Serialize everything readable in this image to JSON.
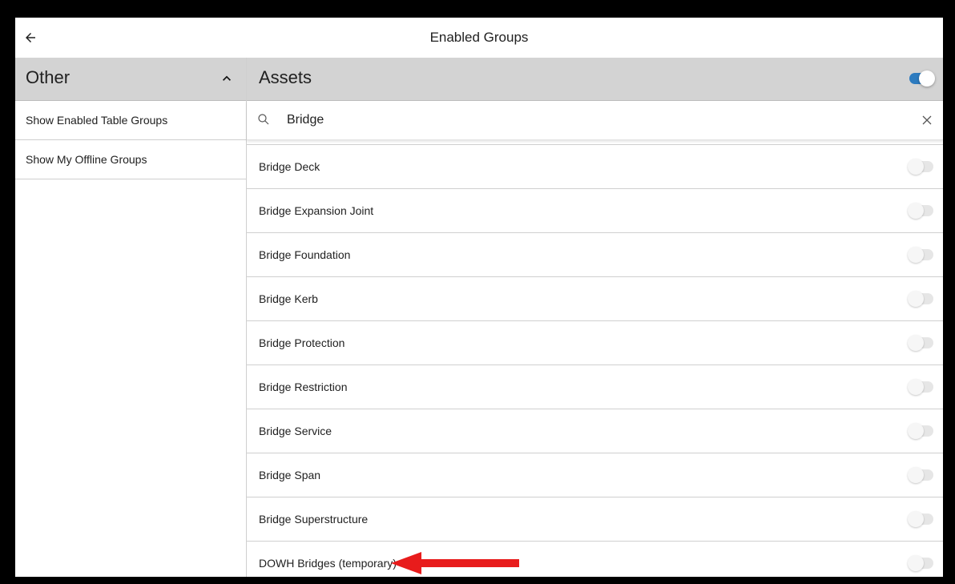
{
  "header": {
    "title": "Enabled Groups",
    "back_icon": "arrow-back-icon"
  },
  "left_panel": {
    "title": "Other",
    "collapse_icon": "chevron-up-icon",
    "items": [
      {
        "label": "Show Enabled Table Groups"
      },
      {
        "label": "Show My Offline Groups"
      }
    ]
  },
  "right_panel": {
    "title": "Assets",
    "toggle_enabled": true,
    "search": {
      "value": "Bridge",
      "placeholder": "",
      "icon": "search-icon",
      "clear_icon": "close-icon"
    },
    "items": [
      {
        "label": "Bridge Deck",
        "enabled": false
      },
      {
        "label": "Bridge Expansion Joint",
        "enabled": false
      },
      {
        "label": "Bridge Foundation",
        "enabled": false
      },
      {
        "label": "Bridge Kerb",
        "enabled": false
      },
      {
        "label": "Bridge Protection",
        "enabled": false
      },
      {
        "label": "Bridge Restriction",
        "enabled": false
      },
      {
        "label": "Bridge Service",
        "enabled": false
      },
      {
        "label": "Bridge Span",
        "enabled": false
      },
      {
        "label": "Bridge Superstructure",
        "enabled": false
      },
      {
        "label": "DOWH Bridges (temporary)",
        "enabled": false
      }
    ]
  },
  "annotation": {
    "icon": "red-arrow-icon",
    "color": "#e81c1c"
  },
  "colors": {
    "accent": "#2d7bbf",
    "header_bg": "#d3d3d3",
    "frame": "#000000"
  }
}
